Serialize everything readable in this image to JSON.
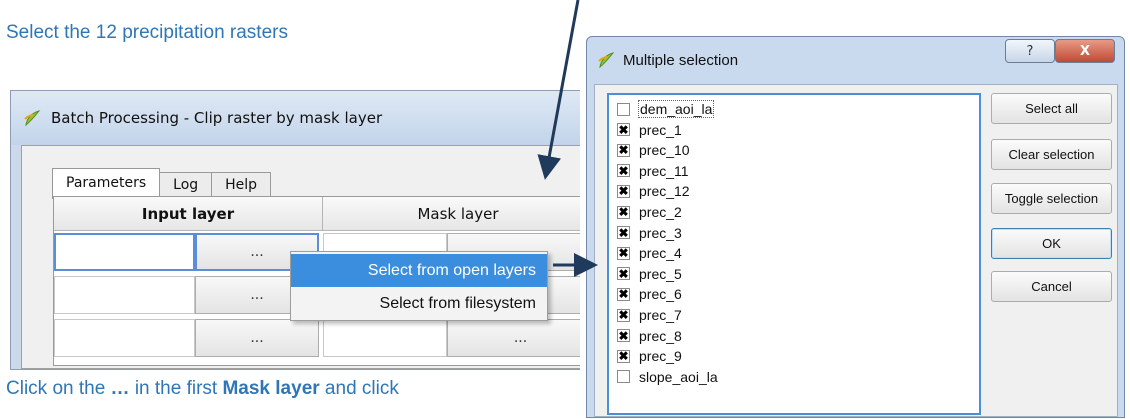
{
  "captions": {
    "top": "Select the 12 precipitation rasters",
    "bottom_pre": "Click on the ",
    "bottom_ellipsis": "…",
    "bottom_mid": " in the first ",
    "bottom_bold": "Mask layer",
    "bottom_post": " and click"
  },
  "batch_window": {
    "title": "Batch Processing - Clip raster by mask layer",
    "tabs": [
      "Parameters",
      "Log",
      "Help"
    ],
    "columns": [
      "Input layer",
      "Mask layer"
    ],
    "ellipsis": "..."
  },
  "context_menu": {
    "items": [
      "Select from open layers",
      "Select from filesystem"
    ]
  },
  "dialog": {
    "title": "Multiple selection",
    "help_label": "?",
    "close_label": "X",
    "items": [
      {
        "label": "dem_aoi_la",
        "checked": false
      },
      {
        "label": "prec_1",
        "checked": true
      },
      {
        "label": "prec_10",
        "checked": true
      },
      {
        "label": "prec_11",
        "checked": true
      },
      {
        "label": "prec_12",
        "checked": true
      },
      {
        "label": "prec_2",
        "checked": true
      },
      {
        "label": "prec_3",
        "checked": true
      },
      {
        "label": "prec_4",
        "checked": true
      },
      {
        "label": "prec_5",
        "checked": true
      },
      {
        "label": "prec_6",
        "checked": true
      },
      {
        "label": "prec_7",
        "checked": true
      },
      {
        "label": "prec_8",
        "checked": true
      },
      {
        "label": "prec_9",
        "checked": true
      },
      {
        "label": "slope_aoi_la",
        "checked": false
      }
    ],
    "buttons": {
      "select_all": "Select all",
      "clear_selection": "Clear selection",
      "toggle_selection": "Toggle selection",
      "ok": "OK",
      "cancel": "Cancel"
    }
  },
  "colors": {
    "caption": "#2f76b6",
    "highlight": "#3b8ede",
    "arrow": "#1f3a5a"
  }
}
